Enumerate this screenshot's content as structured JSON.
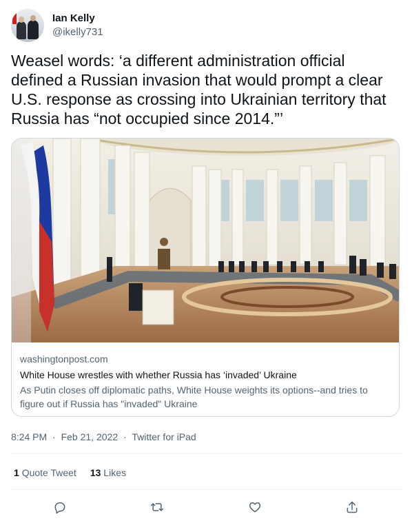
{
  "author": {
    "display_name": "Ian Kelly",
    "handle": "@ikelly731",
    "avatar_icon": "profile-photo"
  },
  "tweet": {
    "text": "Weasel words: ‘a different administration official defined a Russian invasion that would prompt a clear U.S. response as crossing into Ukrainian territory that Russia has “not occupied since 2014.”’"
  },
  "link_card": {
    "domain": "washingtonpost.com",
    "title": "White House wrestles with whether Russia has ‘invaded’ Ukraine",
    "description": "As Putin closes off diplomatic paths, White House weights its options--and tries to figure out if Russia has \"invaded\" Ukraine"
  },
  "meta": {
    "time": "8:24 PM",
    "date": "Feb 21, 2022",
    "separator": "·",
    "source": "Twitter for iPad"
  },
  "stats": {
    "quote_count": "1",
    "quote_label": "Quote Tweet",
    "like_count": "13",
    "like_label": "Likes"
  },
  "actions": [
    "reply-icon",
    "retweet-icon",
    "like-icon",
    "share-icon"
  ],
  "colors": {
    "text_primary": "#0f1419",
    "text_secondary": "#536471",
    "border": "#cfd9de"
  }
}
